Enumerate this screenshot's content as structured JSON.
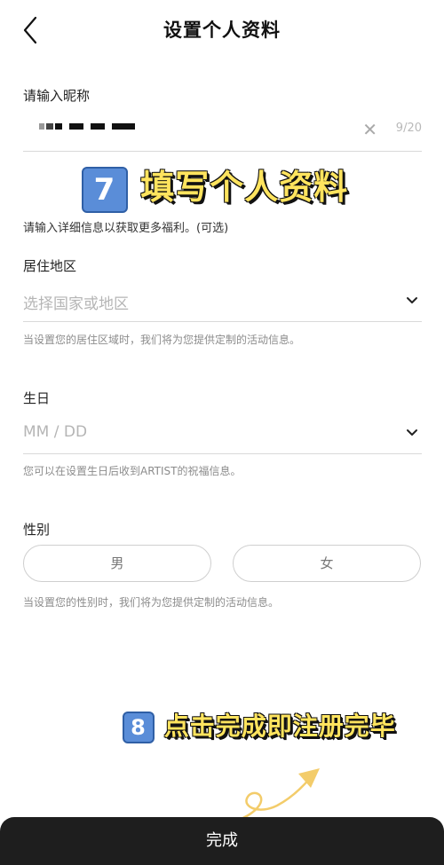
{
  "header": {
    "title": "设置个人资料"
  },
  "nickname": {
    "label": "请输入昵称",
    "counter": "9/20"
  },
  "callouts": {
    "step7_badge": "7",
    "step7_text": "填写个人资料",
    "step8_badge": "8",
    "step8_text": "点击完成即注册完毕"
  },
  "intro": "请输入详细信息以获取更多福利。(可选)",
  "region": {
    "label": "居住地区",
    "placeholder": "选择国家或地区",
    "hint": "当设置您的居住区域时，我们将为您提供定制的活动信息。"
  },
  "birthday": {
    "label": "生日",
    "placeholder": "MM / DD",
    "hint": "您可以在设置生日后收到ARTIST的祝福信息。"
  },
  "gender": {
    "label": "性别",
    "male": "男",
    "female": "女",
    "hint": "当设置您的性别时，我们将为您提供定制的活动信息。"
  },
  "footer": {
    "done_label": "完成"
  },
  "colors": {
    "callout_yellow": "#ffe45e",
    "footer_bg": "#1e1e1e",
    "badge_blue": "#5a8dd8"
  }
}
